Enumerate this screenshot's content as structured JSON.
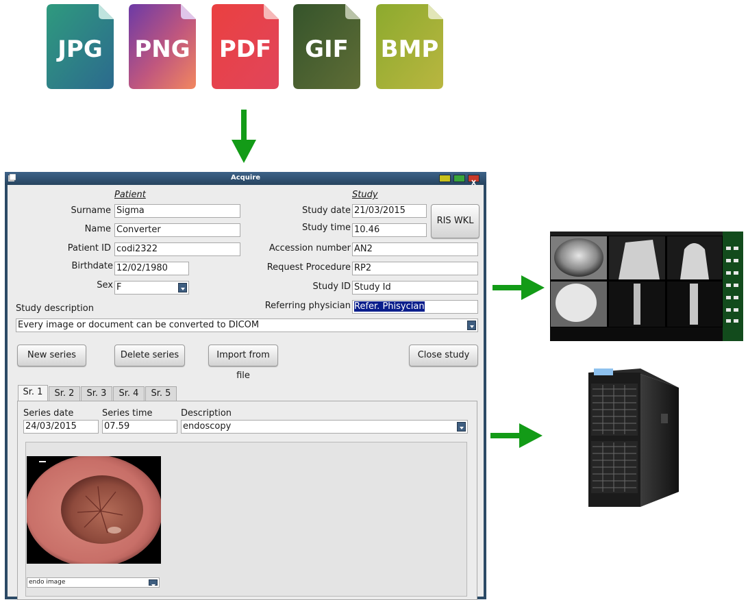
{
  "file_formats": [
    {
      "label": "JPG",
      "color_top": "#2f8e80",
      "color_bottom": "#2c6d8c"
    },
    {
      "label": "PNG",
      "color_top": "#7b3f9f",
      "color_bottom": "#ef7a63"
    },
    {
      "label": "PDF",
      "color_top": "#e8403f",
      "color_bottom": "#e2435a"
    },
    {
      "label": "GIF",
      "color_top": "#3c5a2a",
      "color_bottom": "#5b6b35"
    },
    {
      "label": "BMP",
      "color_top": "#8aa730",
      "color_bottom": "#b7b63e"
    }
  ],
  "colors": {
    "arrow": "#139b17",
    "window_frame": "#2c4a66",
    "selection": "#0a1e8c"
  },
  "window": {
    "title": "Acquire",
    "icon": "app-icon"
  },
  "patient": {
    "heading": "Patient",
    "surname_label": "Surname",
    "surname": "Sigma",
    "name_label": "Name",
    "name": "Converter",
    "id_label": "Patient ID",
    "id": "codi2322",
    "birthdate_label": "Birthdate",
    "birthdate": "12/02/1980",
    "sex_label": "Sex",
    "sex": "F"
  },
  "study": {
    "heading": "Study",
    "date_label": "Study date",
    "date": "21/03/2015",
    "time_label": "Study time",
    "time": "10.46",
    "accession_label": "Accession number",
    "accession": "AN2",
    "request_label": "Request Procedure",
    "request": "RP2",
    "study_id_label": "Study ID",
    "study_id": "Study Id",
    "referring_label": "Referring physician",
    "referring": "Refer. Phisycian",
    "ris_button": "RIS WKL",
    "description_label": "Study description",
    "description": "Every image or document can be converted to DICOM"
  },
  "buttons": {
    "new_series": "New series",
    "delete_series": "Delete series",
    "import_file": "Import from file",
    "close_study": "Close study"
  },
  "tabs": [
    "Sr. 1",
    "Sr. 2",
    "Sr. 3",
    "Sr. 4",
    "Sr. 5"
  ],
  "series": {
    "date_label": "Series date",
    "date": "24/03/2015",
    "time_label": "Series time",
    "time": "07.59",
    "description_label": "Description",
    "description": "endoscopy",
    "image_caption": "endo image"
  }
}
